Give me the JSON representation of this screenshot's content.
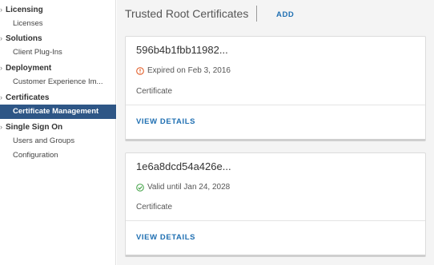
{
  "sidebar": {
    "groups": [
      {
        "label": "Licensing",
        "items": [
          {
            "label": "Licenses",
            "active": false
          }
        ]
      },
      {
        "label": "Solutions",
        "items": [
          {
            "label": "Client Plug-Ins",
            "active": false
          }
        ]
      },
      {
        "label": "Deployment",
        "items": [
          {
            "label": "Customer Experience Im...",
            "active": false
          }
        ]
      },
      {
        "label": "Certificates",
        "items": [
          {
            "label": "Certificate Management",
            "active": true
          }
        ]
      },
      {
        "label": "Single Sign On",
        "items": [
          {
            "label": "Users and Groups",
            "active": false
          },
          {
            "label": "Configuration",
            "active": false
          }
        ]
      }
    ]
  },
  "main": {
    "title": "Trusted Root Certificates",
    "add_label": "ADD",
    "cards": [
      {
        "name": "596b4b1fbb11982...",
        "status": "Expired on Feb 3, 2016",
        "status_icon": "warning-circle-icon",
        "status_color": "#e0531a",
        "type": "Certificate",
        "action_label": "VIEW DETAILS"
      },
      {
        "name": "1e6a8dcd54a426e...",
        "status": "Valid until Jan 24, 2028",
        "status_icon": "check-circle-icon",
        "status_color": "#3ea042",
        "type": "Certificate",
        "action_label": "VIEW DETAILS"
      }
    ]
  },
  "colors": {
    "accent": "#1f6fb2",
    "active_nav": "#2e5686"
  }
}
